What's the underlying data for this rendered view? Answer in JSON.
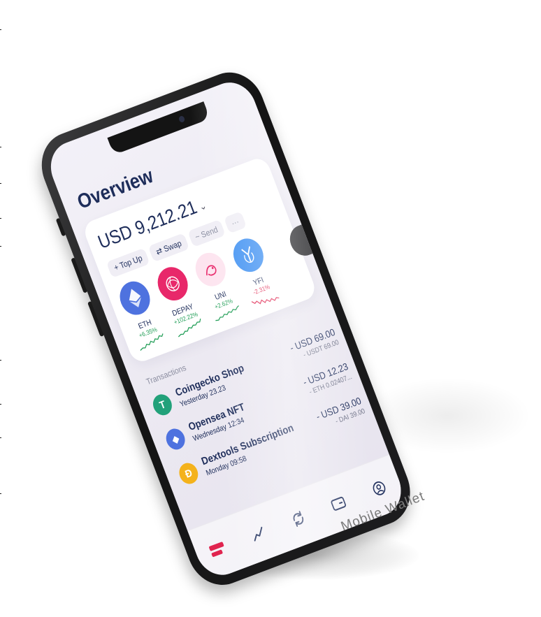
{
  "caption": "Mobile Wallet",
  "app": {
    "title": "Overview",
    "balance": "USD 9,212.21",
    "actions": [
      {
        "label": "+ Top Up"
      },
      {
        "label": "⇄ Swap"
      },
      {
        "label": "~ Send"
      },
      {
        "label": "···"
      }
    ],
    "coins": [
      {
        "name": "ETH",
        "change": "+6.35%",
        "color": "#4e72df",
        "trend": "up"
      },
      {
        "name": "DEPAY",
        "change": "+102.22%",
        "color": "#e8286a",
        "trend": "up"
      },
      {
        "name": "UNI",
        "change": "+2.62%",
        "color": "#fde4ef",
        "trend": "up"
      },
      {
        "name": "YFI",
        "change": "-2.31%",
        "color": "#3c8ff2",
        "trend": "down"
      }
    ],
    "transactions_title": "Transactions",
    "transactions": [
      {
        "name": "Coingecko Shop",
        "time": "Yesterday 23.23",
        "amount": "- USD 69.00",
        "sub": "- USDT 69.00",
        "icon": "tether-icon",
        "icon_color": "#22a17a",
        "glyph": "T"
      },
      {
        "name": "Opensea NFT",
        "time": "Wednesday 12:34",
        "amount": "- USD 12.23",
        "sub": "- ETH 0.02407...",
        "icon": "ethereum-icon",
        "icon_color": "#4e72df",
        "glyph": "◆"
      },
      {
        "name": "Dextools Subscription",
        "time": "Monday 09:58",
        "amount": "- USD 39.00",
        "sub": "- DAI 39.00",
        "icon": "dai-icon",
        "icon_color": "#f4b21b",
        "glyph": "Ð"
      }
    ],
    "accent_color": "#e0244f",
    "positive_color": "#1f9d55",
    "negative_color": "#e0244f"
  }
}
